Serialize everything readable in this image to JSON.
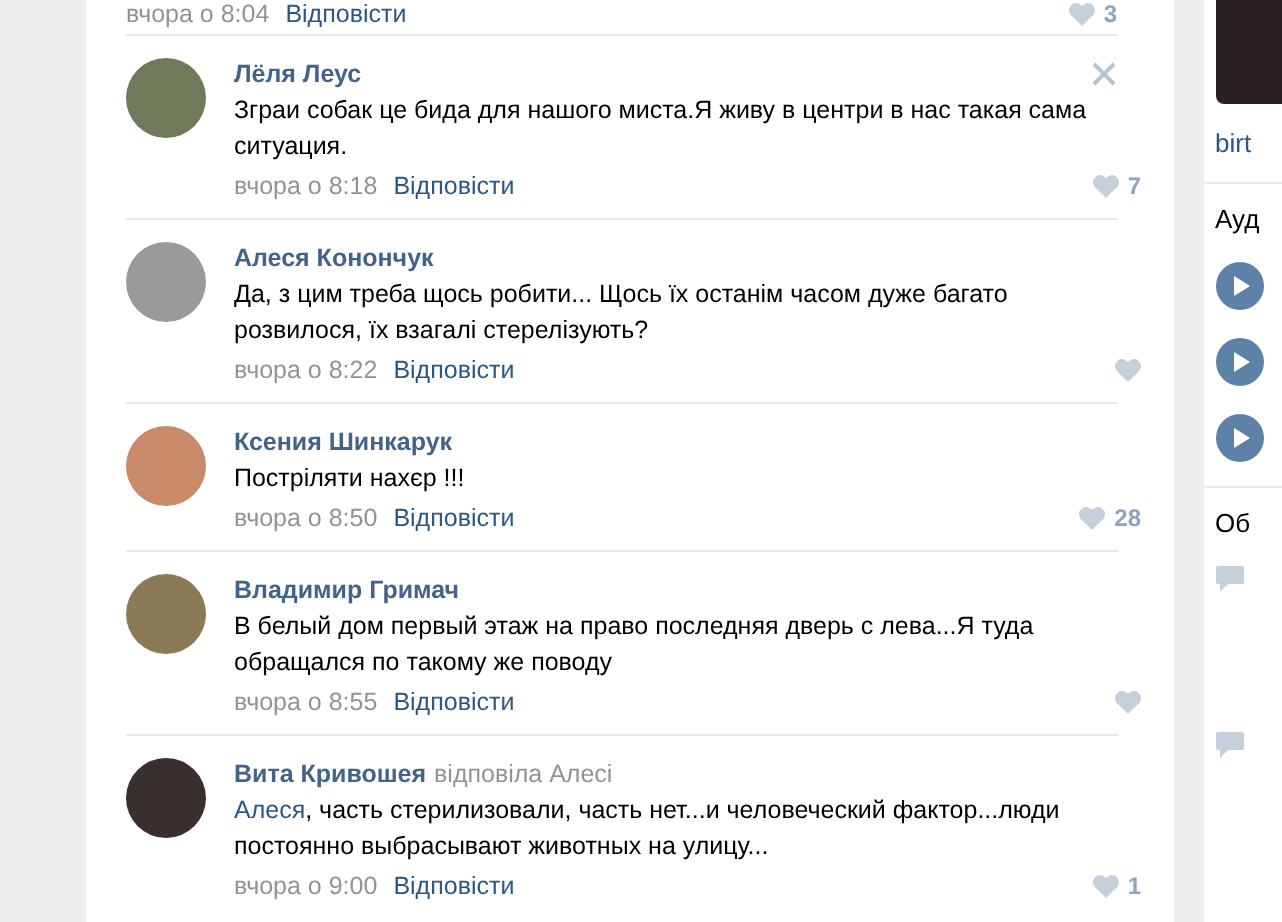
{
  "previous_comment": {
    "time": "вчора о 8:04",
    "reply": "Відповісти",
    "likes": "3"
  },
  "comments": [
    {
      "author": "Лёля Леус",
      "text": "Зграи собак це бида для нашого миста.Я живу в центри в нас такая сама ситуация.",
      "time": "вчора о 8:18",
      "reply": "Відповісти",
      "likes": "7",
      "closable": true
    },
    {
      "author": "Алеся Конончук",
      "text": "Да, з цим треба щось робити... Щось їх останім часом дуже багато розвилося, їх взагалі стерелізують?",
      "time": "вчора о 8:22",
      "reply": "Відповісти",
      "closable": false
    },
    {
      "author": "Ксения Шинкарук",
      "text": "Постріляти нахєр !!!",
      "time": "вчора о 8:50",
      "reply": "Відповісти",
      "likes": "28",
      "closable": false
    },
    {
      "author": "Владимир Гримач",
      "text": "В белый дом первый этаж на право последняя дверь с лева...Я туда обращался по такому же поводу",
      "time": "вчора о 8:55",
      "reply": "Відповісти",
      "closable": false
    },
    {
      "author": "Вита Кривошея",
      "reply_note": "відповіла Алесі",
      "mention": "Алеся",
      "text": ", часть стерилизовали, часть нет...и человеческий фактор...люди постоянно выбрасывают животных на улицу...",
      "time": "вчора о 9:00",
      "reply": "Відповісти",
      "likes": "1",
      "closable": false
    }
  ],
  "sidebar": {
    "link": "birt",
    "audio_heading": "Ауд",
    "discussion_heading": "Об"
  }
}
